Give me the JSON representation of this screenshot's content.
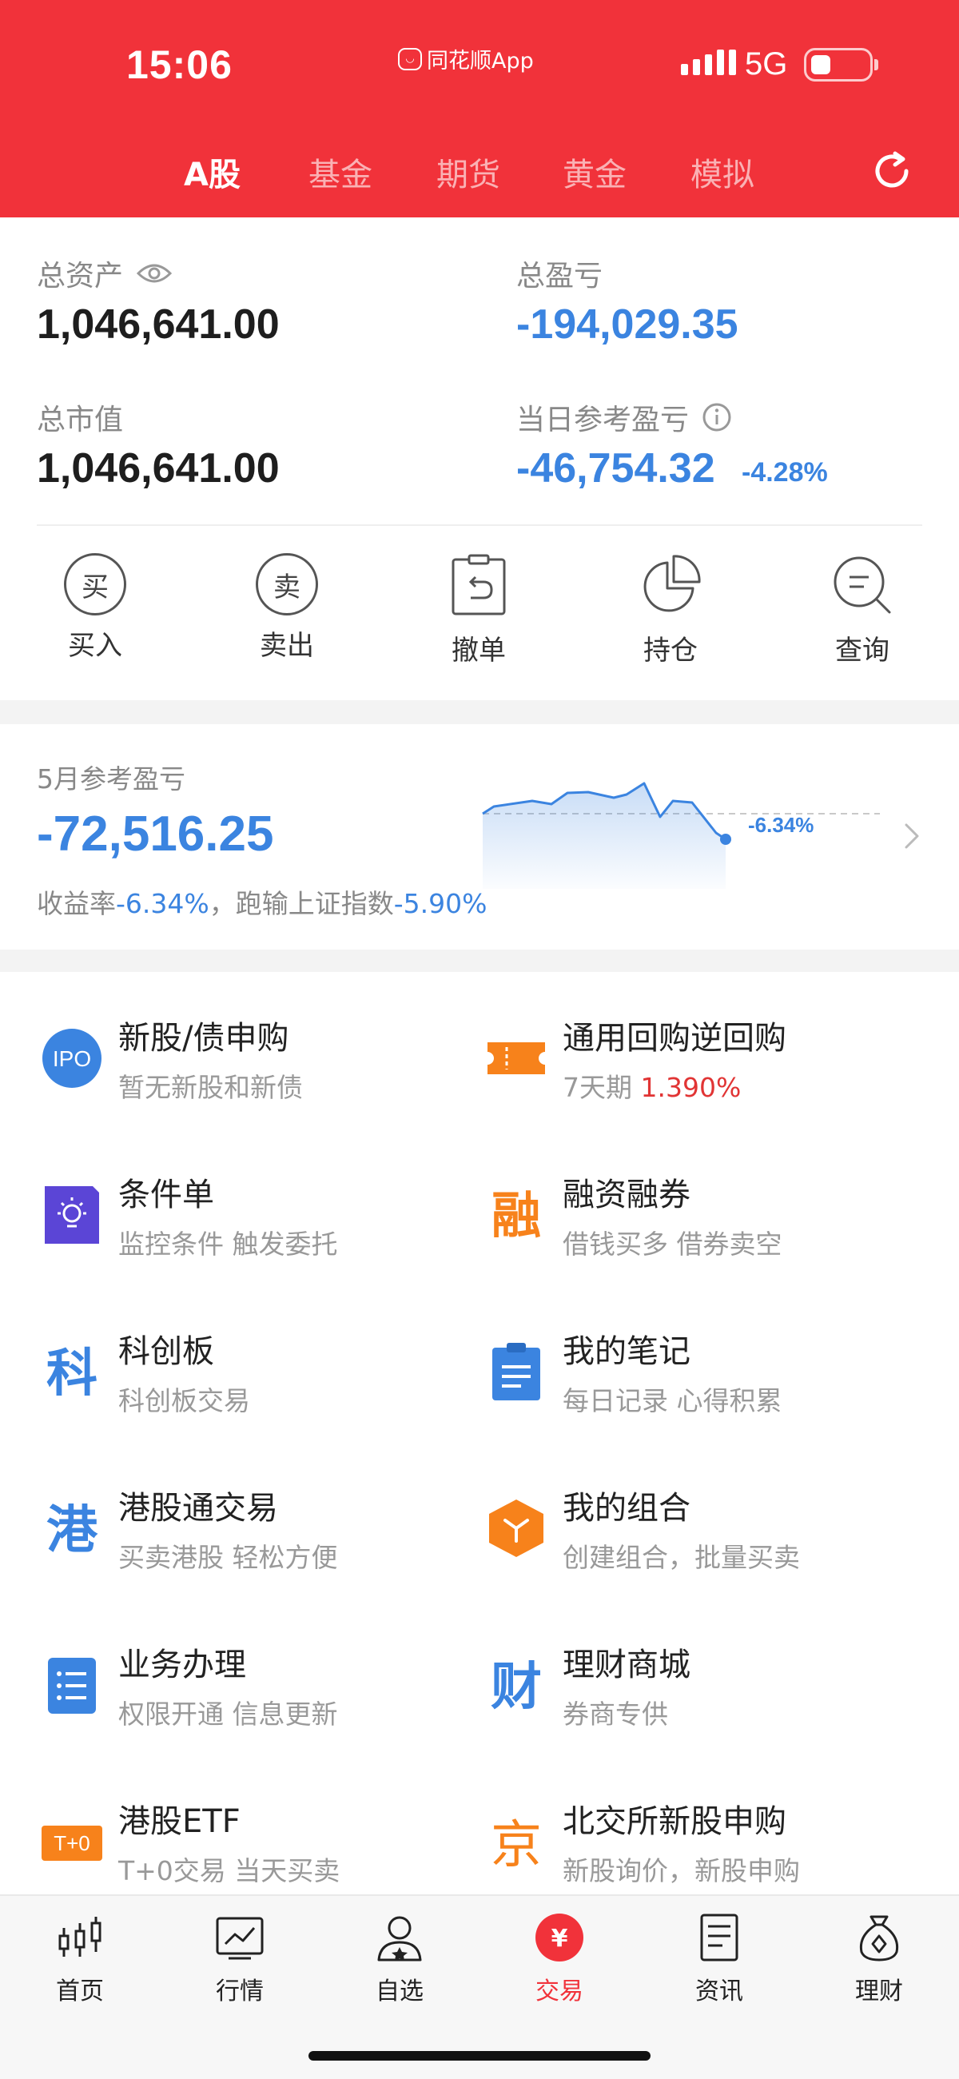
{
  "status_bar": {
    "time": "15:06",
    "app_name": "同花顺App",
    "network": "5G"
  },
  "tabs": [
    {
      "label": "A股",
      "active": true
    },
    {
      "label": "基金",
      "active": false
    },
    {
      "label": "期货",
      "active": false
    },
    {
      "label": "黄金",
      "active": false
    },
    {
      "label": "模拟",
      "active": false
    }
  ],
  "assets": {
    "total_assets_label": "总资产",
    "total_assets_value": "1,046,641.00",
    "total_pl_label": "总盈亏",
    "total_pl_value": "-194,029.35",
    "market_value_label": "总市值",
    "market_value_value": "1,046,641.00",
    "daily_pl_label": "当日参考盈亏",
    "daily_pl_value": "-46,754.32",
    "daily_pl_pct": "-4.28%"
  },
  "actions": [
    {
      "label": "买入",
      "glyph": "买"
    },
    {
      "label": "卖出",
      "glyph": "卖"
    },
    {
      "label": "撤单"
    },
    {
      "label": "持仓"
    },
    {
      "label": "查询"
    }
  ],
  "monthly": {
    "title": "5月参考盈亏",
    "value": "-72,516.25",
    "note_prefix": "收益率",
    "note_rate": "-6.34%",
    "note_middle": "，跑输上证指数",
    "note_index": "-5.90%",
    "chart_label": "-6.34%"
  },
  "services": [
    {
      "title": "新股/债申购",
      "sub": "暂无新股和新债",
      "icon": "ipo-icon",
      "icon_text": "IPO"
    },
    {
      "title": "通用回购逆回购",
      "sub_prefix": "7天期 ",
      "sub_highlight": "1.390%",
      "icon": "ticket-icon"
    },
    {
      "title": "条件单",
      "sub": "监控条件 触发委托",
      "icon": "condition-icon"
    },
    {
      "title": "融资融券",
      "sub": "借钱买多 借券卖空",
      "icon": "margin-icon",
      "icon_text": "融"
    },
    {
      "title": "科创板",
      "sub": "科创板交易",
      "icon": "star-market-icon",
      "icon_text": "科"
    },
    {
      "title": "我的笔记",
      "sub": "每日记录 心得积累",
      "icon": "notes-icon"
    },
    {
      "title": "港股通交易",
      "sub": "买卖港股 轻松方便",
      "icon": "hk-connect-icon",
      "icon_text": "港"
    },
    {
      "title": "我的组合",
      "sub": "创建组合，批量买卖",
      "icon": "portfolio-icon"
    },
    {
      "title": "业务办理",
      "sub": "权限开通 信息更新",
      "icon": "business-icon"
    },
    {
      "title": "理财商城",
      "sub": "券商专供",
      "icon": "wealth-mall-icon",
      "icon_text": "财"
    },
    {
      "title": "港股ETF",
      "sub": "T+0交易 当天买卖",
      "icon": "hk-etf-icon",
      "icon_text": "T+0"
    },
    {
      "title": "北交所新股申购",
      "sub": "新股询价，新股申购",
      "icon": "bse-icon",
      "icon_text": "京"
    }
  ],
  "bottom_nav": [
    {
      "label": "首页",
      "icon": "candlestick-icon"
    },
    {
      "label": "行情",
      "icon": "market-chart-icon"
    },
    {
      "label": "自选",
      "icon": "user-star-icon"
    },
    {
      "label": "交易",
      "icon": "trade-icon",
      "active": true,
      "icon_text": "¥"
    },
    {
      "label": "资讯",
      "icon": "news-icon"
    },
    {
      "label": "理财",
      "icon": "money-bag-icon"
    }
  ],
  "colors": {
    "brand_red": "#f1323a",
    "loss_blue": "#3b84e0",
    "gain_red": "#e13434",
    "orange": "#f7821b"
  }
}
